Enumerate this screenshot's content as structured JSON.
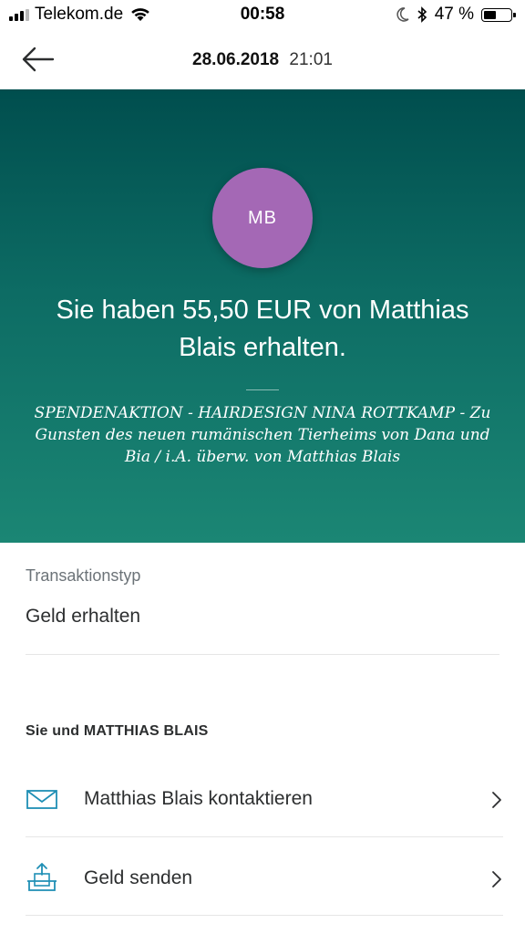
{
  "status_bar": {
    "carrier": "Telekom.de",
    "time": "00:58",
    "battery_percent": "47 %",
    "battery_level": 0.47
  },
  "header": {
    "date": "28.06.2018",
    "time": "21:01"
  },
  "transaction": {
    "avatar_initials": "MB",
    "avatar_color": "#a468b5",
    "headline": "Sie haben 55,50 EUR von Matthias Blais erhalten.",
    "memo": "SPENDENAKTION - HAIRDESIGN NINA ROTTKAMP - Zu Gunsten des neuen rumänischen Tierheims von Dana und Bia / i.A. überw. von Matthias Blais",
    "type_label": "Transaktionstyp",
    "type_value": "Geld erhalten"
  },
  "section": {
    "title": "Sie und MATTHIAS BLAIS"
  },
  "actions": [
    {
      "label": "Matthias Blais kontaktieren",
      "icon": "mail-icon"
    },
    {
      "label": "Geld senden",
      "icon": "send-money-icon"
    }
  ],
  "colors": {
    "hero_top": "#004e4e",
    "hero_bottom": "#1b8674",
    "accent_icon": "#1f8fb5"
  }
}
